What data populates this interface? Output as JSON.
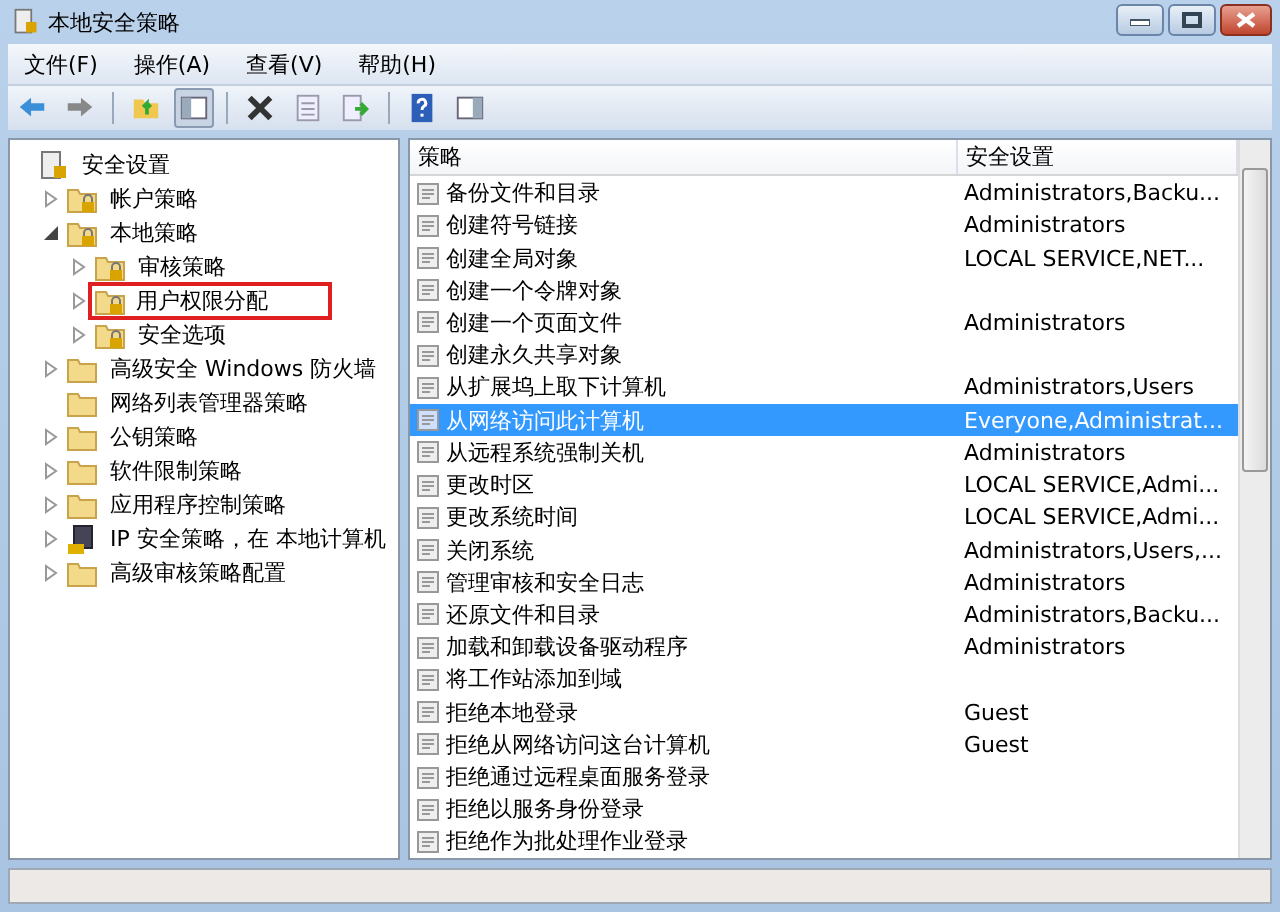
{
  "window": {
    "title": "本地安全策略"
  },
  "menu": [
    "文件(F)",
    "操作(A)",
    "查看(V)",
    "帮助(H)"
  ],
  "toolbar": [
    {
      "kind": "back",
      "pressed": false
    },
    {
      "kind": "forward",
      "pressed": false
    },
    {
      "kind": "separator"
    },
    {
      "kind": "up",
      "pressed": false
    },
    {
      "kind": "tree",
      "pressed": true
    },
    {
      "kind": "separator"
    },
    {
      "kind": "delete",
      "pressed": false
    },
    {
      "kind": "properties",
      "pressed": false
    },
    {
      "kind": "export",
      "pressed": false
    },
    {
      "kind": "separator"
    },
    {
      "kind": "help",
      "pressed": false
    },
    {
      "kind": "pane",
      "pressed": false
    }
  ],
  "tree": [
    {
      "label": "安全设置",
      "kind": "root",
      "marked": false,
      "children": [
        {
          "label": "帐户策略",
          "kind": "locked-folder",
          "expanded": false,
          "marked": false
        },
        {
          "label": "本地策略",
          "kind": "locked-folder",
          "expanded": true,
          "marked": false,
          "children": [
            {
              "label": "审核策略",
              "kind": "locked-folder",
              "expanded": false,
              "marked": false
            },
            {
              "label": "用户权限分配",
              "kind": "locked-folder",
              "expanded": false,
              "marked": true
            },
            {
              "label": "安全选项",
              "kind": "locked-folder",
              "expanded": false,
              "marked": false
            }
          ]
        },
        {
          "label": "高级安全 Windows 防火墙",
          "kind": "folder",
          "expanded": false,
          "marked": false
        },
        {
          "label": "网络列表管理器策略",
          "kind": "folder",
          "marked": false
        },
        {
          "label": "公钥策略",
          "kind": "folder",
          "expanded": false,
          "marked": false
        },
        {
          "label": "软件限制策略",
          "kind": "folder",
          "expanded": false,
          "marked": false
        },
        {
          "label": "应用程序控制策略",
          "kind": "folder",
          "expanded": false,
          "marked": false
        },
        {
          "label": "IP 安全策略，在 本地计算机",
          "kind": "computer",
          "expanded": false,
          "marked": false
        },
        {
          "label": "高级审核策略配置",
          "kind": "folder",
          "expanded": false,
          "marked": false
        }
      ]
    }
  ],
  "table": {
    "columns": [
      "策略",
      "安全设置"
    ],
    "rows": [
      {
        "policy": "备份文件和目录",
        "setting": "Administrators,Backu...",
        "selected": false
      },
      {
        "policy": "创建符号链接",
        "setting": "Administrators",
        "selected": false
      },
      {
        "policy": "创建全局对象",
        "setting": "LOCAL SERVICE,NET...",
        "selected": false
      },
      {
        "policy": "创建一个令牌对象",
        "selected": false
      },
      {
        "policy": "创建一个页面文件",
        "setting": "Administrators",
        "selected": false
      },
      {
        "policy": "创建永久共享对象",
        "selected": false
      },
      {
        "policy": "从扩展坞上取下计算机",
        "setting": "Administrators,Users",
        "selected": false
      },
      {
        "policy": "从网络访问此计算机",
        "setting": "Everyone,Administrat...",
        "selected": true
      },
      {
        "policy": "从远程系统强制关机",
        "setting": "Administrators",
        "selected": false
      },
      {
        "policy": "更改时区",
        "setting": "LOCAL SERVICE,Admi...",
        "selected": false
      },
      {
        "policy": "更改系统时间",
        "setting": "LOCAL SERVICE,Admi...",
        "selected": false
      },
      {
        "policy": "关闭系统",
        "setting": "Administrators,Users,...",
        "selected": false
      },
      {
        "policy": "管理审核和安全日志",
        "setting": "Administrators",
        "selected": false
      },
      {
        "policy": "还原文件和目录",
        "setting": "Administrators,Backu...",
        "selected": false
      },
      {
        "policy": "加载和卸载设备驱动程序",
        "setting": "Administrators",
        "selected": false
      },
      {
        "policy": "将工作站添加到域",
        "selected": false
      },
      {
        "policy": "拒绝本地登录",
        "setting": "Guest",
        "selected": false
      },
      {
        "policy": "拒绝从网络访问这台计算机",
        "setting": "Guest",
        "selected": false
      },
      {
        "policy": "拒绝通过远程桌面服务登录",
        "selected": false
      },
      {
        "policy": "拒绝以服务身份登录",
        "selected": false
      },
      {
        "policy": "拒绝作为批处理作业登录",
        "selected": false
      }
    ]
  }
}
